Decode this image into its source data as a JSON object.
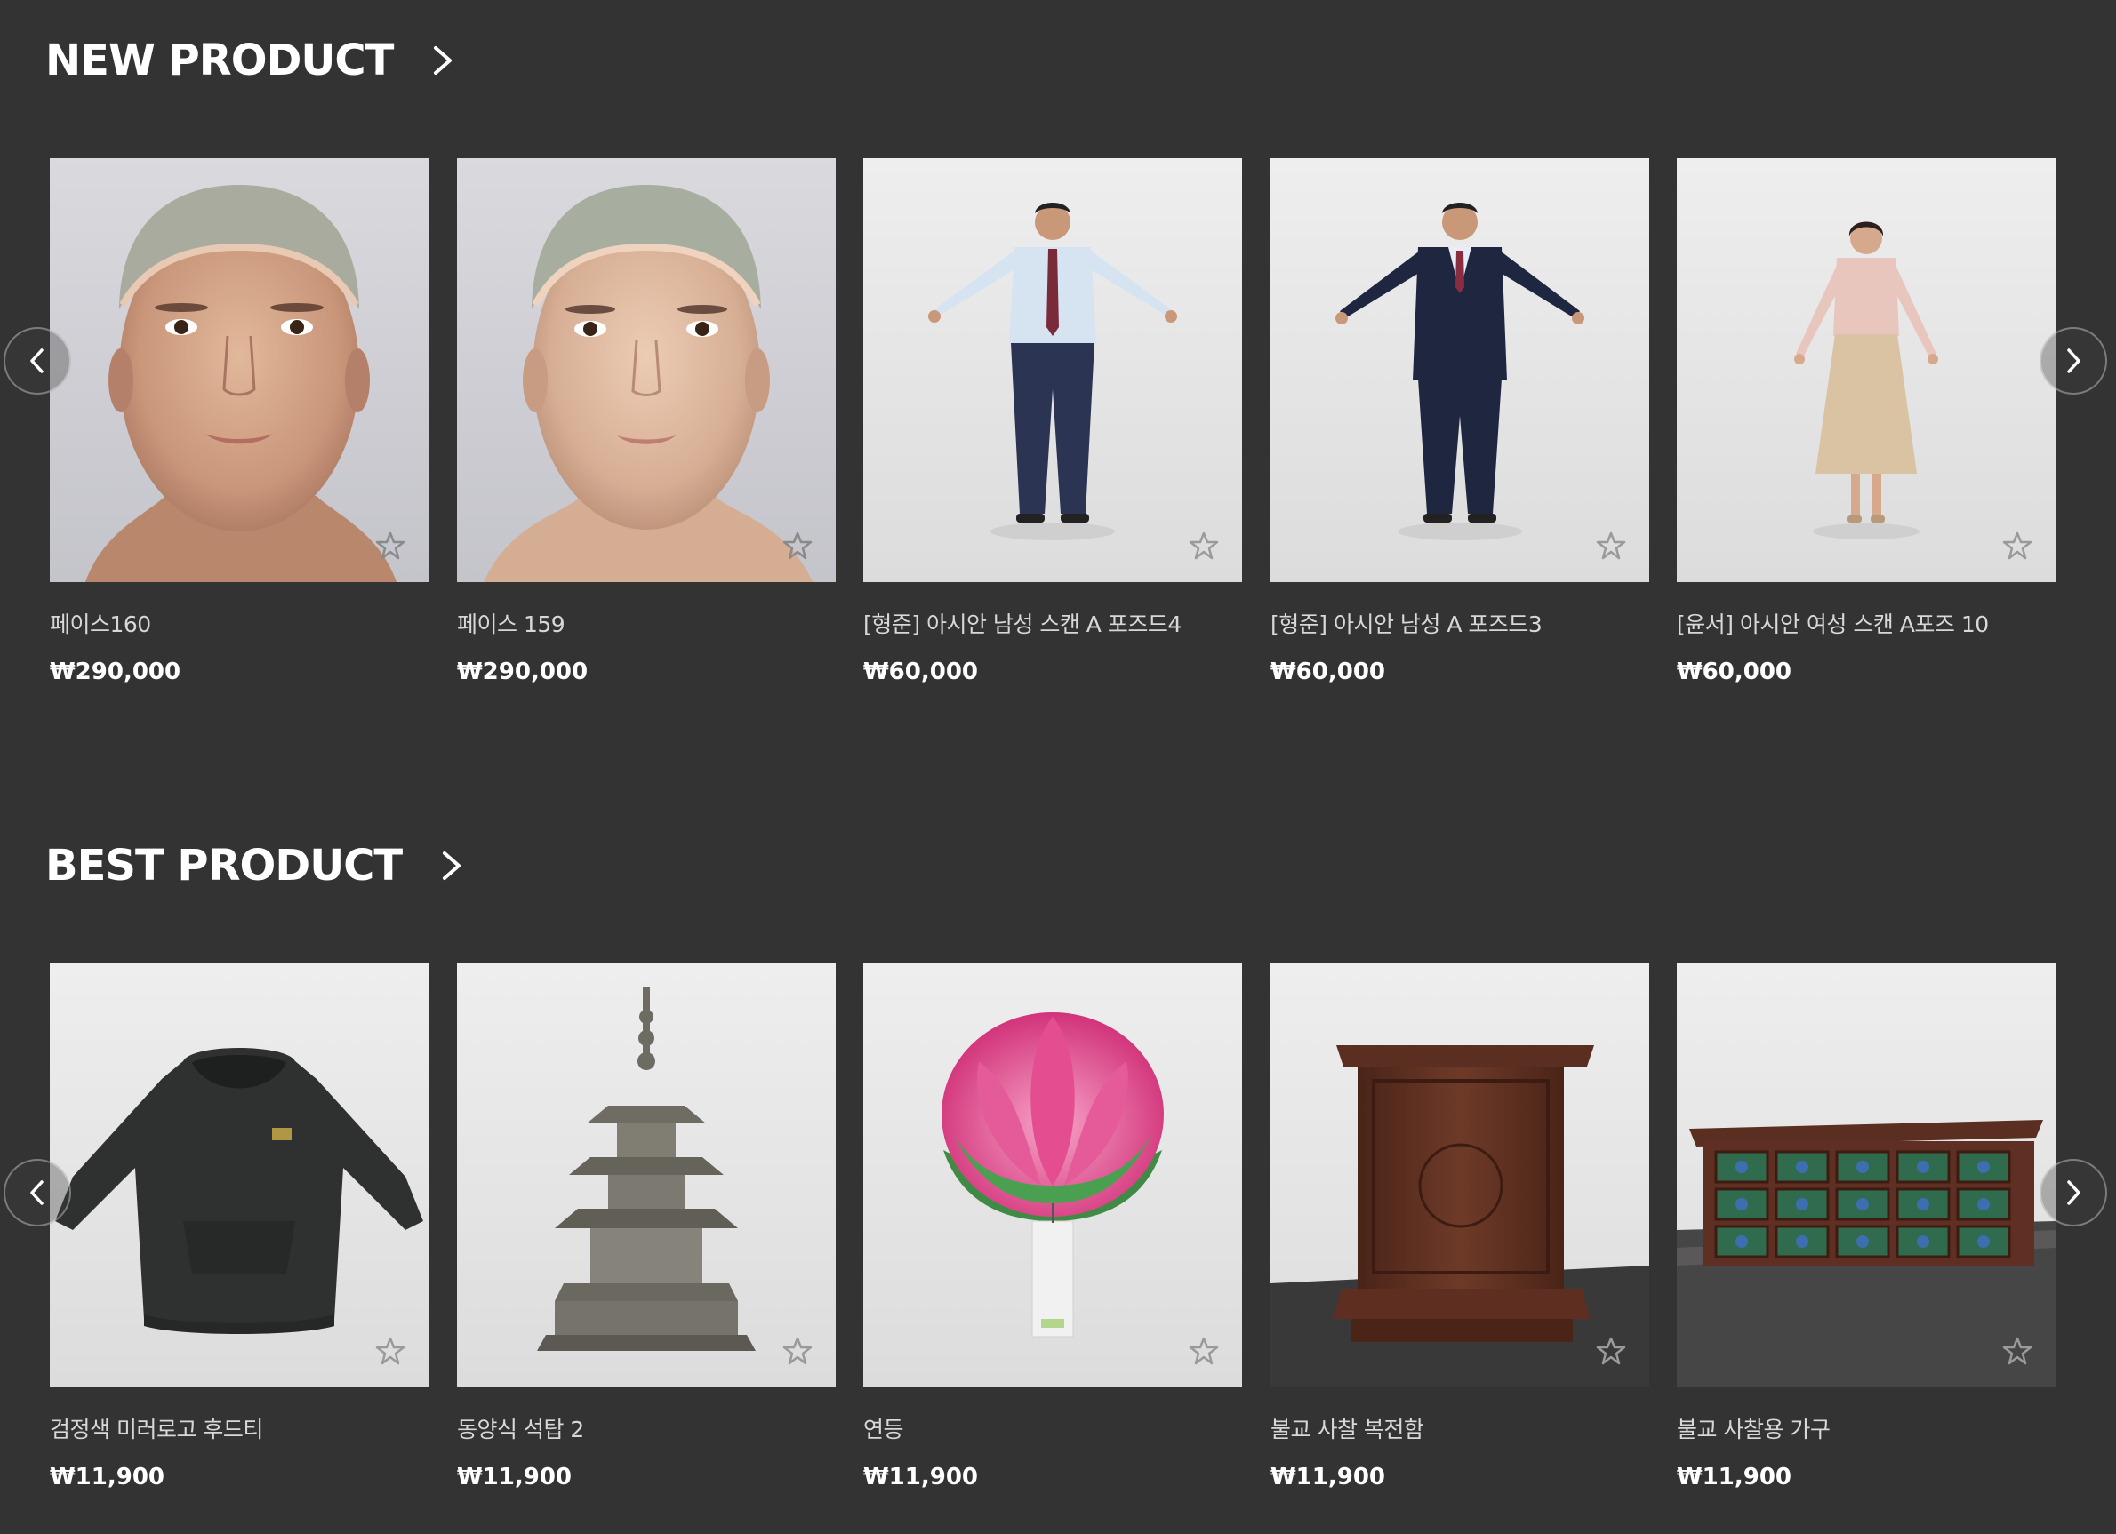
{
  "sections": [
    {
      "title": "NEW PRODUCT",
      "products": [
        {
          "title": "페이스160",
          "price": "₩290,000"
        },
        {
          "title": "페이스 159",
          "price": "₩290,000"
        },
        {
          "title": "[형준] 아시안 남성 스캔 A 포즈드4",
          "price": "₩60,000"
        },
        {
          "title": "[형준] 아시안 남성 A 포즈드3",
          "price": "₩60,000"
        },
        {
          "title": "[윤서] 아시안 여성 스캔 A포즈 10",
          "price": "₩60,000"
        }
      ]
    },
    {
      "title": "BEST PRODUCT",
      "products": [
        {
          "title": "검정색 미러로고 후드티",
          "price": "₩11,900"
        },
        {
          "title": "동양식 석탑 2",
          "price": "₩11,900"
        },
        {
          "title": "연등",
          "price": "₩11,900"
        },
        {
          "title": "불교 사찰 복전함",
          "price": "₩11,900"
        },
        {
          "title": "불교 사찰용 가구",
          "price": "₩11,900"
        }
      ]
    }
  ],
  "icons": {
    "section_arrow": "chevron-right-icon",
    "favorite": "star-outline-icon",
    "carousel_prev": "chevron-left-icon",
    "carousel_next": "chevron-right-icon"
  },
  "colors": {
    "background": "#333333",
    "title": "#ffffff",
    "product_name": "#d8d8d8",
    "price": "#ffffff"
  }
}
